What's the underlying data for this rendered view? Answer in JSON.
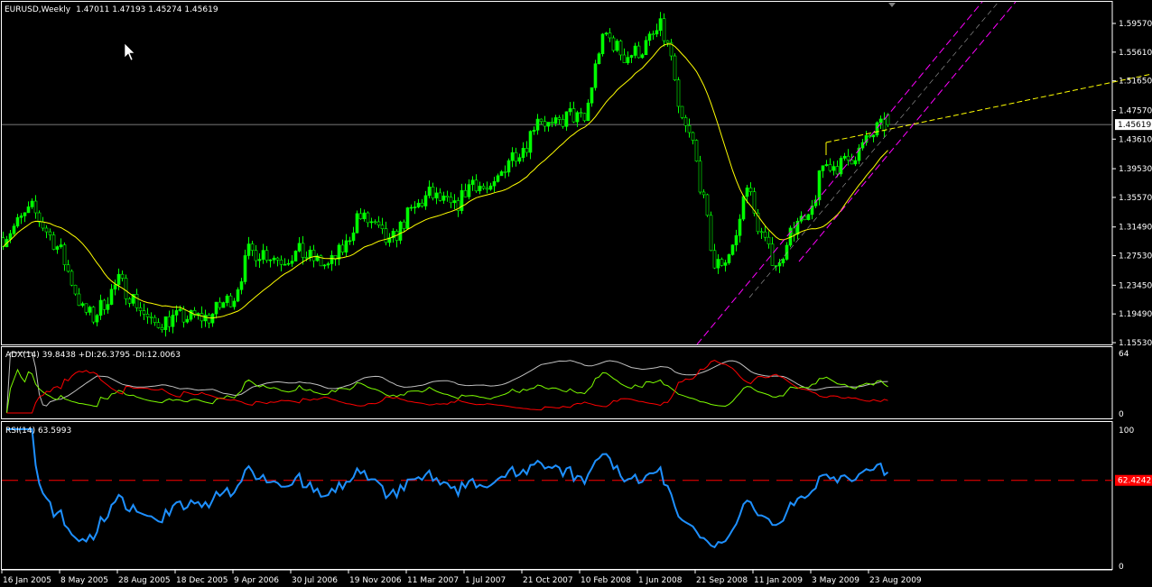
{
  "header": {
    "symbol_timeframe": "EURUSD,Weekly",
    "ohlc": "1.47011 1.47193 1.45274 1.45619"
  },
  "colors": {
    "background": "#000000",
    "candles": "#00ff00",
    "moving_average": "#ffff00",
    "trendlines": "#ff00ff",
    "adx": "#c0c0c0",
    "plus_di": "#7cfc00",
    "minus_di": "#ff0000",
    "rsi": "#1e90ff",
    "rsi_level": "#ff0000",
    "frame": "#ffffff"
  },
  "chart_data": [
    {
      "type": "candlestick",
      "title": "EURUSD,Weekly",
      "timeframe": "Weekly",
      "ohlc_last": {
        "open": 1.47011,
        "high": 1.47193,
        "low": 1.45274,
        "close": 1.45619
      },
      "current_price_label": "1.45619",
      "y_ticks": [
        "1.59570",
        "1.55610",
        "1.51650",
        "1.47570",
        "1.43610",
        "1.39530",
        "1.35570",
        "1.31490",
        "1.27530",
        "1.23450",
        "1.19490",
        "1.15530"
      ],
      "ylim": [
        1.1553,
        1.5957
      ],
      "x_ticks": [
        "16 Jan 2005",
        "8 May 2005",
        "28 Aug 2005",
        "18 Dec 2005",
        "9 Apr 2006",
        "30 Jul 2006",
        "19 Nov 2006",
        "11 Mar 2007",
        "1 Jul 2007",
        "21 Oct 2007",
        "10 Feb 2008",
        "1 Jun 2008",
        "21 Sep 2008",
        "11 Jan 2009",
        "3 May 2009",
        "23 Aug 2009"
      ],
      "approx_close": [
        [
          "2005-01-16",
          1.3
        ],
        [
          "2005-03-13",
          1.34
        ],
        [
          "2005-05-08",
          1.28
        ],
        [
          "2005-06-19",
          1.2
        ],
        [
          "2005-07-10",
          1.19
        ],
        [
          "2005-08-28",
          1.24
        ],
        [
          "2005-10-02",
          1.21
        ],
        [
          "2005-10-30",
          1.18
        ],
        [
          "2005-12-18",
          1.19
        ],
        [
          "2006-02-19",
          1.19
        ],
        [
          "2006-03-19",
          1.21
        ],
        [
          "2006-04-09",
          1.22
        ],
        [
          "2006-05-07",
          1.28
        ],
        [
          "2006-06-04",
          1.28
        ],
        [
          "2006-07-09",
          1.27
        ],
        [
          "2006-08-13",
          1.28
        ],
        [
          "2006-10-08",
          1.26
        ],
        [
          "2006-11-12",
          1.29
        ],
        [
          "2006-12-03",
          1.33
        ],
        [
          "2006-12-31",
          1.32
        ],
        [
          "2007-02-04",
          1.29
        ],
        [
          "2007-03-11",
          1.33
        ],
        [
          "2007-04-22",
          1.36
        ],
        [
          "2007-06-10",
          1.34
        ],
        [
          "2007-07-15",
          1.38
        ],
        [
          "2007-08-19",
          1.36
        ],
        [
          "2007-09-23",
          1.41
        ],
        [
          "2007-10-28",
          1.43
        ],
        [
          "2007-11-18",
          1.47
        ],
        [
          "2007-12-16",
          1.45
        ],
        [
          "2008-01-20",
          1.47
        ],
        [
          "2008-02-17",
          1.46
        ],
        [
          "2008-03-16",
          1.56
        ],
        [
          "2008-03-30",
          1.58
        ],
        [
          "2008-05-04",
          1.55
        ],
        [
          "2008-06-08",
          1.56
        ],
        [
          "2008-07-13",
          1.59
        ],
        [
          "2008-08-03",
          1.55
        ],
        [
          "2008-08-17",
          1.47
        ],
        [
          "2008-09-14",
          1.43
        ],
        [
          "2008-10-12",
          1.32
        ],
        [
          "2008-10-26",
          1.26
        ],
        [
          "2008-11-16",
          1.27
        ],
        [
          "2008-12-07",
          1.3
        ],
        [
          "2008-12-28",
          1.38
        ],
        [
          "2009-01-11",
          1.33
        ],
        [
          "2009-02-08",
          1.28
        ],
        [
          "2009-03-01",
          1.26
        ],
        [
          "2009-03-15",
          1.3
        ],
        [
          "2009-04-05",
          1.32
        ],
        [
          "2009-04-26",
          1.32
        ],
        [
          "2009-05-24",
          1.4
        ],
        [
          "2009-06-28",
          1.4
        ],
        [
          "2009-08-02",
          1.42
        ],
        [
          "2009-09-06",
          1.45
        ],
        [
          "2009-09-27",
          1.45619
        ]
      ],
      "moving_average_period": 20
    },
    {
      "type": "line",
      "indicator": "ADX(14)",
      "label": "ADX(14) 39.8438 +DI:26.3795 -DI:12.0063",
      "values": {
        "adx": 39.8438,
        "plus_di": 26.3795,
        "minus_di": 12.0063
      },
      "y_ticks": [
        "64",
        "0"
      ],
      "ylim": [
        0,
        64
      ]
    },
    {
      "type": "line",
      "indicator": "RSI(14)",
      "label": "RSI(14) 63.5993",
      "value": 63.5993,
      "level": 62.4242,
      "level_label": "62.4242",
      "y_ticks": [
        "100",
        "0"
      ],
      "ylim": [
        0,
        100
      ]
    }
  ]
}
